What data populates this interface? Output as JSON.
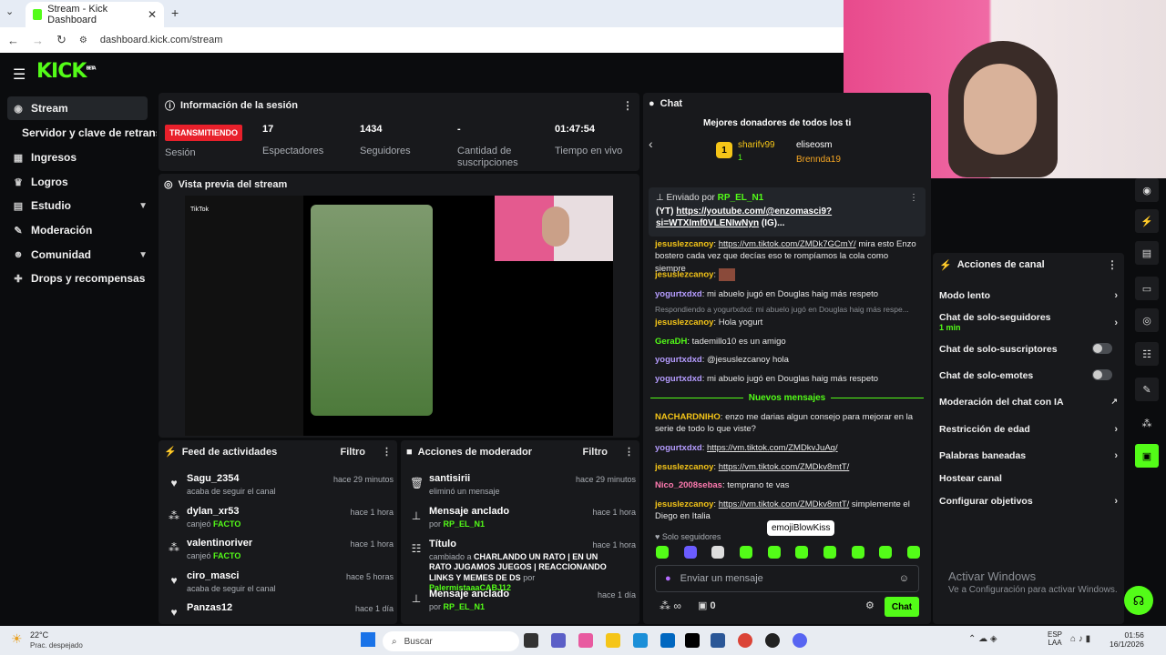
{
  "browser": {
    "tab_title": "Stream - Kick Dashboard",
    "new_tab": "+",
    "url": "dashboard.kick.com/stream"
  },
  "header": {
    "logo": "KICK",
    "logo_sup": "BETA"
  },
  "sidebar": {
    "items": [
      {
        "label": "Stream",
        "icon": "stream-icon"
      },
      {
        "label": "Servidor y clave de retransm"
      },
      {
        "label": "Ingresos",
        "icon": "chart-icon"
      },
      {
        "label": "Logros",
        "icon": "trophy-icon"
      },
      {
        "label": "Estudio",
        "icon": "studio-icon"
      },
      {
        "label": "Moderación",
        "icon": "wrench-icon"
      },
      {
        "label": "Comunidad",
        "icon": "people-icon"
      },
      {
        "label": "Drops y recompensas",
        "icon": "gift-icon"
      }
    ]
  },
  "session": {
    "title": "Información de la sesión",
    "badge": "TRANSMITIENDO",
    "badge_label": "Sesión",
    "stats": [
      {
        "value": "17",
        "label": "Espectadores"
      },
      {
        "value": "1434",
        "label": "Seguidores"
      },
      {
        "value": "-",
        "label": "Cantidad de suscripciones"
      },
      {
        "value": "01:47:54",
        "label": "Tiempo en vivo"
      }
    ]
  },
  "preview": {
    "title": "Vista previa del stream",
    "app": "TikTok"
  },
  "feed": {
    "title": "Feed de actividades",
    "filter": "Filtro",
    "items": [
      {
        "name": "Sagu_2354",
        "time": "hace 29 minutos",
        "sub": "acaba de seguir el canal",
        "icon": "heart-icon"
      },
      {
        "name": "dylan_xr53",
        "time": "hace 1 hora",
        "sub_pre": "canjeó",
        "sub_hl": "FACTO",
        "icon": "points-icon"
      },
      {
        "name": "valentinoriver",
        "time": "hace 1 hora",
        "sub_pre": "canjeó",
        "sub_hl": "FACTO",
        "icon": "points-icon"
      },
      {
        "name": "ciro_masci",
        "time": "hace 5 horas",
        "sub": "acaba de seguir el canal",
        "icon": "heart-icon"
      },
      {
        "name": "Panzas12",
        "time": "hace 1 día",
        "icon": "heart-icon"
      }
    ]
  },
  "mod": {
    "title": "Acciones de moderador",
    "filter": "Filtro",
    "items": [
      {
        "name": "santisirii",
        "time": "hace 29 minutos",
        "sub": "eliminó un mensaje",
        "icon": "trash-icon"
      },
      {
        "name": "Mensaje anclado",
        "time": "hace 1 hora",
        "sub_pre": "por",
        "sub_hl": "RP_EL_N1",
        "icon": "pin-icon"
      },
      {
        "name": "Título",
        "time": "hace 1 hora",
        "sub_pre": "cambiado a",
        "sub_bold": "CHARLANDO UN RATO | EN UN RATO JUGAMOS JUEGOS | REACCIONANDO LINKS Y MEMES DE DS",
        "sub_mid": "por",
        "sub_hl": "PalermistaaaCABJ12",
        "icon": "title-icon"
      },
      {
        "name": "Mensaje anclado",
        "time": "hace 1 día",
        "sub_pre": "por",
        "sub_hl": "RP_EL_N1",
        "icon": "pin-icon"
      }
    ]
  },
  "chat": {
    "title": "Chat",
    "donors_title": "Mejores donadores de todos los ti",
    "donors": [
      {
        "rank": "1",
        "name": "sharifv99",
        "count": "1"
      },
      {
        "name": "eliseosm"
      },
      {
        "name": "Brennda19"
      }
    ],
    "pinned": {
      "label": "Enviado por",
      "user": "RP_EL_N1",
      "text_pre": "(YT)",
      "link": "https://youtube.com/@enzomasci9?si=WTXImf0VLENIwNyn",
      "text_post": "(IG)..."
    },
    "messages": [
      {
        "user": "jesuslezcanoy",
        "color": "#f5c518",
        "link": "https://vm.tiktok.com/ZMDk7GCmY/",
        "text": "mira esto Enzo bostero cada vez que decías eso te rompíamos la cola como siempre"
      },
      {
        "user": "jesuslezcanoy",
        "color": "#f5c518",
        "text": ""
      },
      {
        "user": "yogurtxdxd",
        "color": "#b59cff",
        "text": "mi abuelo jugó en Douglas haig más respeto"
      },
      {
        "reply": "Respondiendo a yogurtxdxd: mi abuelo jugó en Douglas haig más respe..."
      },
      {
        "user": "jesuslezcanoy",
        "color": "#f5c518",
        "text": "Hola yogurt"
      },
      {
        "user": "GeraDH",
        "color": "#53fc18",
        "text": "tademillo10 es un amigo"
      },
      {
        "user": "yogurtxdxd",
        "color": "#b59cff",
        "text": "@jesuslezcanoy hola"
      },
      {
        "user": "yogurtxdxd",
        "color": "#b59cff",
        "text": "mi abuelo jugó en Douglas haig más respeto"
      },
      {
        "divider": "Nuevos mensajes"
      },
      {
        "user": "NACHARDNIHO",
        "color": "#f5c518",
        "text": "enzo me darias algun consejo para mejorar en la serie de todo lo que viste?"
      },
      {
        "user": "yogurtxdxd",
        "color": "#b59cff",
        "link": "https://vm.tiktok.com/ZMDkvJuAq/",
        "text": ""
      },
      {
        "user": "jesuslezcanoy",
        "color": "#f5c518",
        "link": "https://vm.tiktok.com/ZMDkv8mtT/",
        "text": ""
      },
      {
        "user": "Nico_2008sebas",
        "color": "#ff7ab0",
        "text": "temprano te vas"
      },
      {
        "user": "jesuslezcanoy",
        "color": "#f5c518",
        "link": "https://vm.tiktok.com/ZMDkv8mtT/",
        "text": "simplemente el Diego en Italia"
      }
    ],
    "mode": "Solo seguidores",
    "tooltip": "emojiBlowKiss",
    "placeholder": "Enviar un mensaje",
    "points": "0",
    "send": "Chat"
  },
  "actions": {
    "title": "Acciones de canal",
    "items": [
      {
        "label": "Modo lento",
        "kind": "chevron"
      },
      {
        "label": "Chat de solo-seguidores",
        "sub": "1 min",
        "kind": "chevron"
      },
      {
        "label": "Chat de solo-suscriptores",
        "kind": "toggle"
      },
      {
        "label": "Chat de solo-emotes",
        "kind": "toggle"
      },
      {
        "label": "Moderación del chat con IA",
        "kind": "external"
      },
      {
        "label": "Restricción de edad",
        "kind": "chevron"
      },
      {
        "label": "Palabras baneadas",
        "kind": "chevron"
      },
      {
        "label": "Hostear canal",
        "kind": "none"
      },
      {
        "label": "Configurar objetivos",
        "kind": "chevron"
      }
    ]
  },
  "watermark": {
    "title": "Activar Windows",
    "sub": "Ve a Configuración para activar Windows."
  },
  "taskbar": {
    "weather_temp": "22°C",
    "weather_desc": "Prac. despejado",
    "search": "Buscar",
    "lang1": "ESP",
    "lang2": "LAA",
    "time": "01:56",
    "date": "16/1/2026"
  }
}
